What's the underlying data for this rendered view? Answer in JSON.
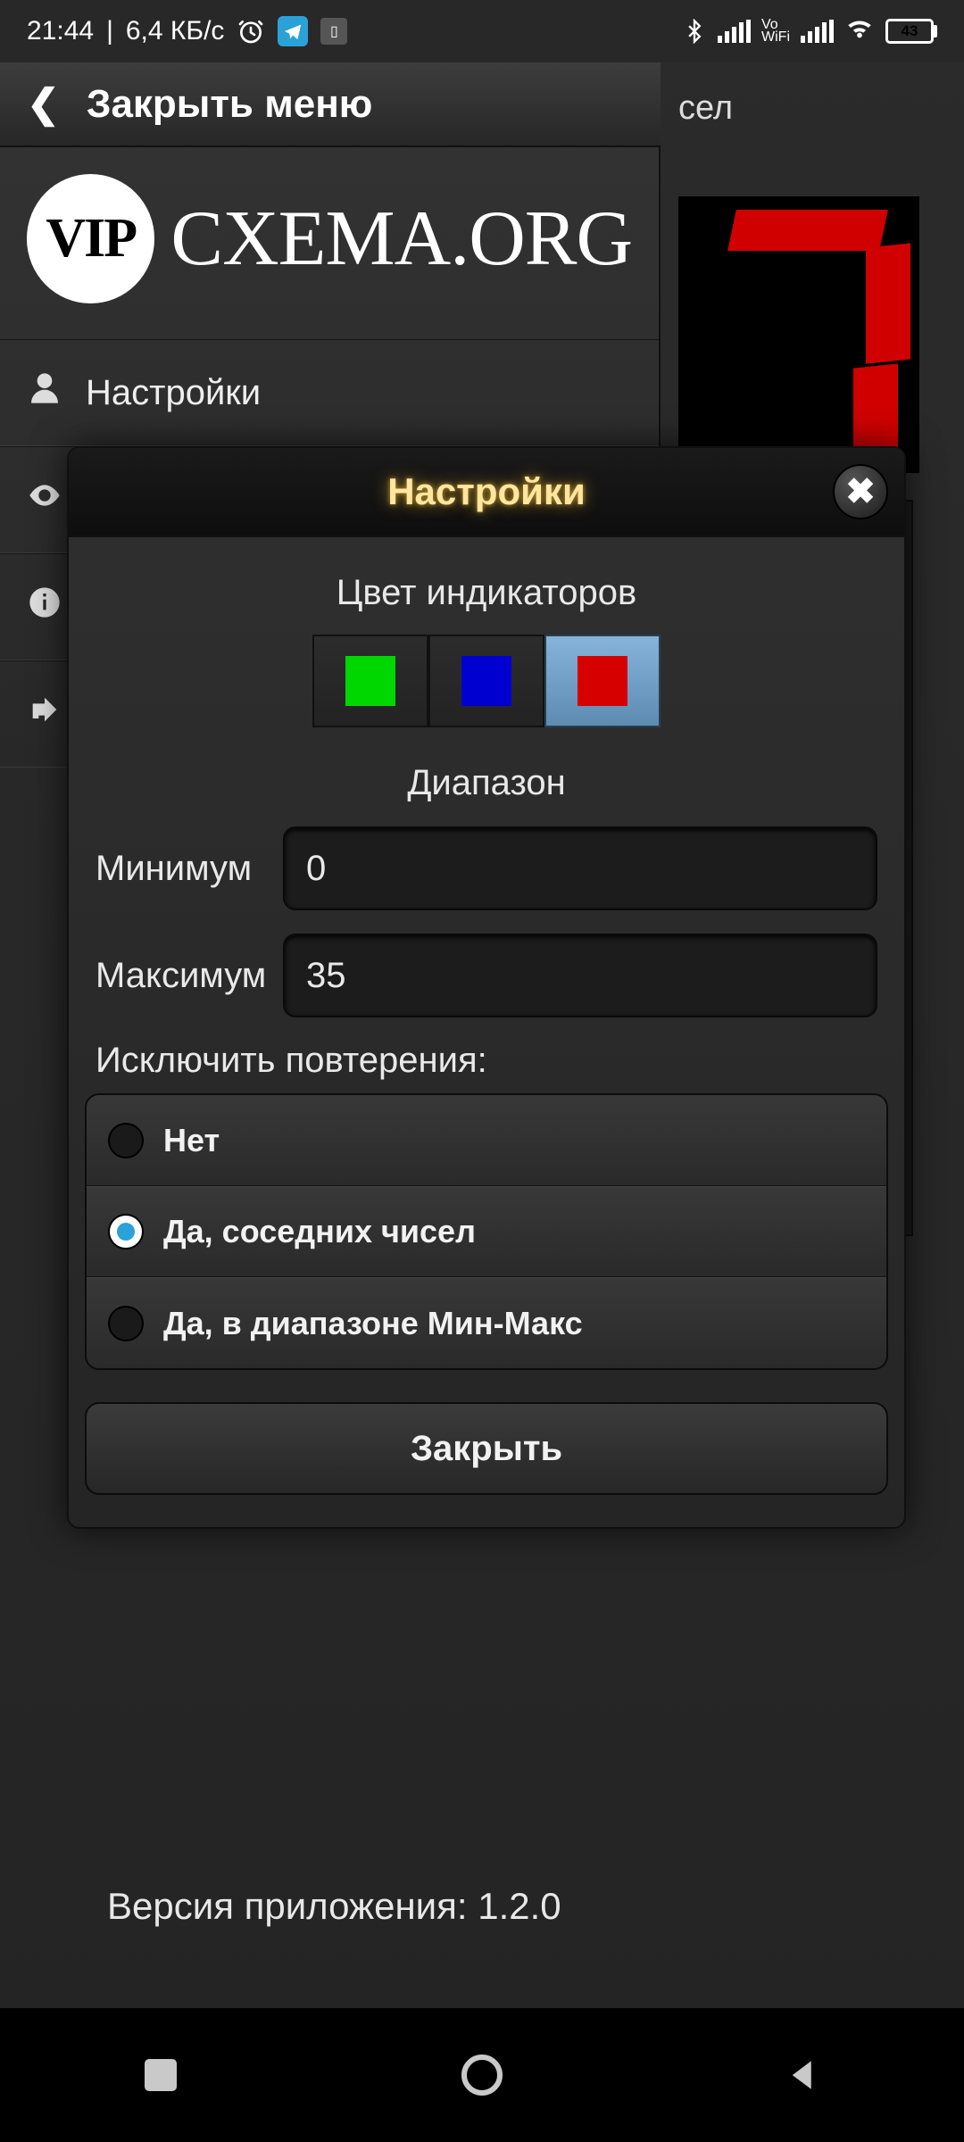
{
  "status_bar": {
    "time": "21:44",
    "speed": "6,4 КБ/с",
    "battery": "43"
  },
  "menu": {
    "close_label": "Закрыть меню",
    "logo_badge": "VIP",
    "logo_text": "CXEMA.ORG",
    "items": [
      {
        "label": "Настройки",
        "icon": "user"
      },
      {
        "label": "",
        "icon": "eye"
      },
      {
        "label": "",
        "icon": "info"
      },
      {
        "label": "",
        "icon": "share"
      }
    ]
  },
  "peek_title_suffix": "сел",
  "dialog": {
    "title": "Настройки",
    "color_section": "Цвет индикаторов",
    "colors": [
      {
        "name": "green",
        "hex": "#00d700",
        "selected": false
      },
      {
        "name": "blue",
        "hex": "#0000d0",
        "selected": false
      },
      {
        "name": "red",
        "hex": "#d70000",
        "selected": true
      }
    ],
    "range_section": "Диапазон",
    "min_label": "Минимум",
    "min_value": "0",
    "max_label": "Максимум",
    "max_value": "35",
    "exclude_label": "Исключить повтерения:",
    "exclude_options": [
      {
        "label": "Нет",
        "selected": false
      },
      {
        "label": "Да, соседних чисел",
        "selected": true
      },
      {
        "label": "Да, в диапазоне Мин-Макс",
        "selected": false
      }
    ],
    "close_button": "Закрыть"
  },
  "footer": {
    "version": "Версия приложения: 1.2.0"
  }
}
